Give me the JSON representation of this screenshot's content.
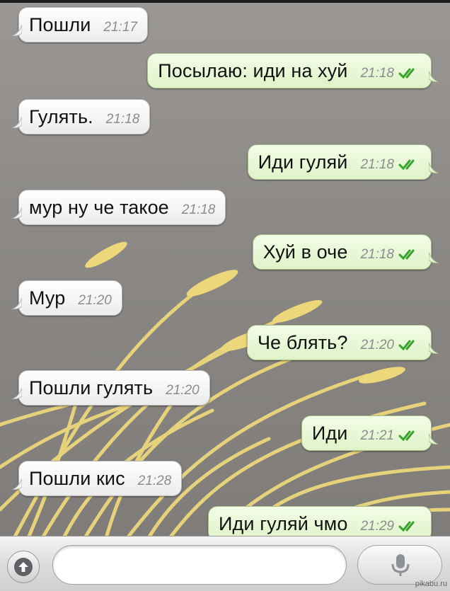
{
  "messages": [
    {
      "side": "in",
      "text": "Пошли",
      "time": "21:17"
    },
    {
      "side": "out",
      "text": "Посылаю: иди на хуй",
      "time": "21:18"
    },
    {
      "side": "in",
      "text": "Гулять.",
      "time": "21:18"
    },
    {
      "side": "out",
      "text": "Иди гуляй",
      "time": "21:18"
    },
    {
      "side": "in",
      "text": "мур ну че такое",
      "time": "21:18"
    },
    {
      "side": "out",
      "text": "Хуй в оче",
      "time": "21:18"
    },
    {
      "side": "in",
      "text": "Мур",
      "time": "21:20"
    },
    {
      "side": "out",
      "text": "Че блять?",
      "time": "21:20"
    },
    {
      "side": "in",
      "text": "Пошли гулять",
      "time": "21:20"
    },
    {
      "side": "out",
      "text": "Иди",
      "time": "21:21"
    },
    {
      "side": "in",
      "text": "Пошли кис",
      "time": "21:28"
    },
    {
      "side": "out",
      "text": "Иди гуляй чмо",
      "time": "21:29"
    }
  ],
  "input": {
    "value": "",
    "placeholder": ""
  },
  "icons": {
    "attach": "upload-arrow-icon",
    "mic": "microphone-icon",
    "read_receipt": "double-check-icon"
  },
  "colors": {
    "tick": "#35a52c",
    "wheat": "#ecd77a",
    "bg": "#8b8885"
  },
  "watermark": "pikabu.ru"
}
